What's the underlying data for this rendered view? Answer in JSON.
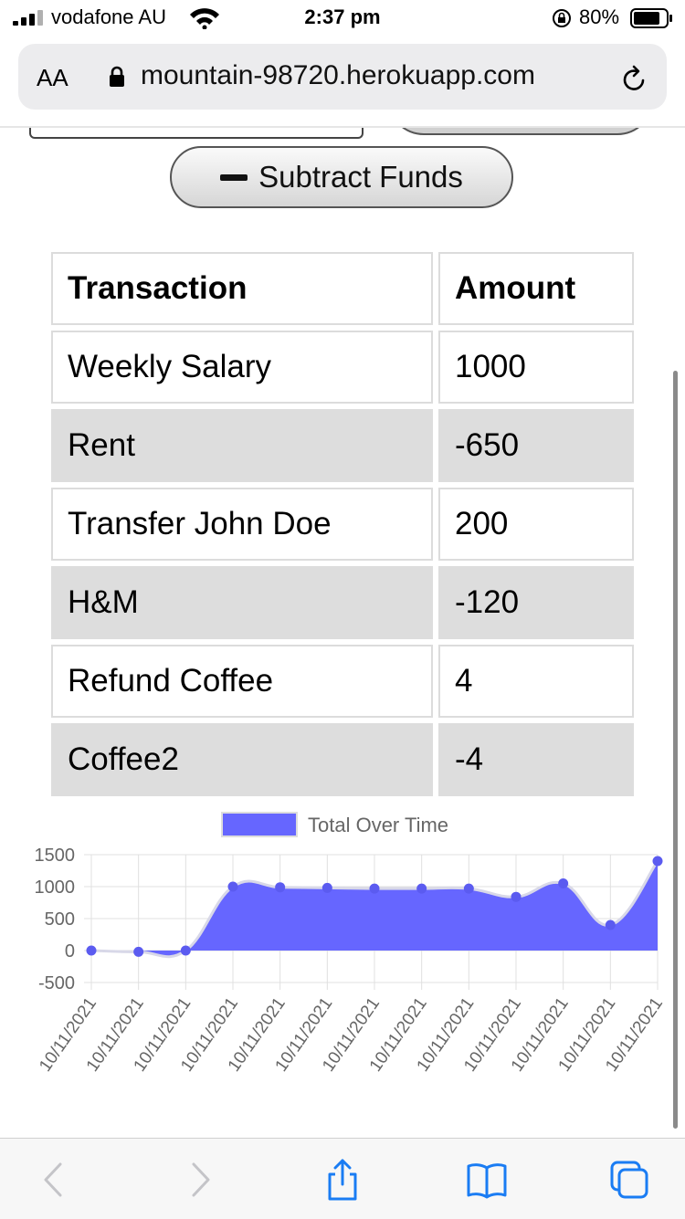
{
  "status_bar": {
    "carrier": "vodafone AU",
    "time": "2:37 pm",
    "battery": "80%"
  },
  "browser": {
    "text_size_label": "AA",
    "url": "mountain-98720.herokuapp.com"
  },
  "actions": {
    "subtract_label": "Subtract Funds"
  },
  "table": {
    "headers": [
      "Transaction",
      "Amount"
    ],
    "rows": [
      {
        "name": "Weekly Salary",
        "amount": "1000"
      },
      {
        "name": "Rent",
        "amount": "-650"
      },
      {
        "name": "Transfer John Doe",
        "amount": "200"
      },
      {
        "name": "H&M",
        "amount": "-120"
      },
      {
        "name": "Refund Coffee",
        "amount": "4"
      },
      {
        "name": "Coffee2",
        "amount": "-4"
      }
    ]
  },
  "colors": {
    "series_fill": "#6666ff",
    "series_point": "#5b5bf0",
    "gray_row": "#dddddd"
  },
  "chart_data": {
    "type": "area",
    "legend": [
      "Total Over Time"
    ],
    "legend_position": "top",
    "grid": true,
    "x": [
      "10/11/2021",
      "10/11/2021",
      "10/11/2021",
      "10/11/2021",
      "10/11/2021",
      "10/11/2021",
      "10/11/2021",
      "10/11/2021",
      "10/11/2021",
      "10/11/2021",
      "10/11/2021",
      "10/11/2021",
      "10/11/2021"
    ],
    "series": [
      {
        "name": "Total Over Time",
        "values": [
          0,
          -20,
          0,
          1000,
          990,
          980,
          970,
          970,
          970,
          840,
          1050,
          400,
          1400
        ]
      }
    ],
    "y_ticks": [
      1500,
      1000,
      500,
      0,
      -500
    ],
    "ylim": [
      -500,
      1500
    ]
  }
}
